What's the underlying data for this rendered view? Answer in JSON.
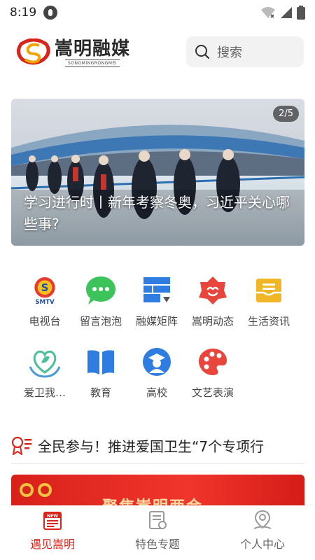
{
  "status_bar": {
    "time": "8:19"
  },
  "header": {
    "logo_cn": "嵩明融媒",
    "logo_en": "SONGMINGRONGMEI",
    "search_placeholder": "搜索"
  },
  "banner": {
    "counter": "2/5",
    "caption": "学习进行时丨新年考察冬奥，习近平关心哪些事?"
  },
  "grid": {
    "items": [
      {
        "label": "电视台",
        "icon": "smtv-logo-icon",
        "icon_text": "SMTV"
      },
      {
        "label": "留言泡泡",
        "icon": "chat-bubble-icon"
      },
      {
        "label": "融媒矩阵",
        "icon": "matrix-grid-icon"
      },
      {
        "label": "嵩明动态",
        "icon": "news-flower-icon"
      },
      {
        "label": "生活资讯",
        "icon": "life-info-icon"
      },
      {
        "label": "爱卫我…",
        "icon": "health-heart-icon"
      },
      {
        "label": "教育",
        "icon": "open-book-icon"
      },
      {
        "label": "高校",
        "icon": "graduate-icon"
      },
      {
        "label": "文艺表演",
        "icon": "palette-icon"
      }
    ]
  },
  "headline": {
    "text": "全民参与！推进爱国卫生“7个专项行"
  },
  "red_card": {
    "title": "聚焦嵩明两会"
  },
  "bottom_nav": {
    "items": [
      {
        "label": "遇见嵩明",
        "icon": "newspaper-icon",
        "badge": "NEW",
        "active": true
      },
      {
        "label": "特色专题",
        "icon": "topic-doc-icon",
        "active": false
      },
      {
        "label": "个人中心",
        "icon": "user-profile-icon",
        "active": false
      }
    ]
  },
  "colors": {
    "accent": "#d8261c",
    "grid_green": "#3cc45a",
    "grid_blue": "#2f7de1",
    "grid_red": "#e8453c",
    "grid_yellow": "#f0b625"
  }
}
